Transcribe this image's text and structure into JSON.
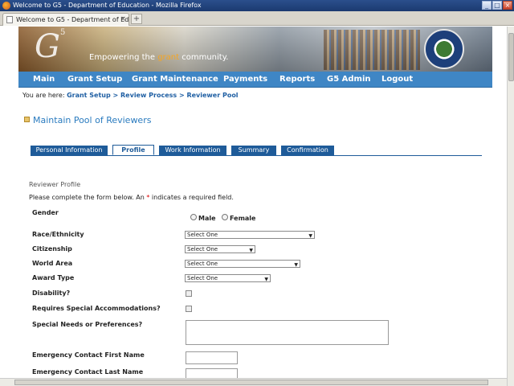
{
  "window": {
    "title": "Welcome to G5 - Department of Education - Mozilla Firefox"
  },
  "browser": {
    "tab_title": "Welcome to G5 - Department of Edu...",
    "tab_close": "×",
    "new_tab": "+"
  },
  "window_controls": {
    "minimize": "_",
    "maximize": "□",
    "close": "×"
  },
  "banner": {
    "logo": "G",
    "logo_sup": "5",
    "tagline_before": "Empowering the ",
    "tagline_highlight": "grant",
    "tagline_after": " community."
  },
  "nav": {
    "items": [
      "Main",
      "Grant Setup",
      "Grant Maintenance",
      "Payments",
      "Reports",
      "G5 Admin",
      "Logout"
    ]
  },
  "breadcrumb": {
    "prefix": "You are here: ",
    "crumbs": [
      "Grant Setup",
      "Review Process",
      "Reviewer Pool"
    ],
    "separator": " > "
  },
  "page_title": "Maintain Pool of Reviewers",
  "form_tabs": [
    "Personal Information",
    "Profile",
    "Work Information",
    "Summary",
    "Confirmation"
  ],
  "active_tab": "Profile",
  "section_title": "Reviewer Profile",
  "instructions": {
    "before": "Please complete the form below. An ",
    "star": "*",
    "after": " indicates a required field."
  },
  "fields": {
    "gender": {
      "label": "Gender",
      "options": [
        "Male",
        "Female"
      ]
    },
    "race": {
      "label": "Race/Ethnicity",
      "value": "Select One"
    },
    "citizenship": {
      "label": "Citizenship",
      "value": "Select One"
    },
    "world_area": {
      "label": "World Area",
      "value": "Select One"
    },
    "award_type": {
      "label": "Award Type",
      "value": "Select One"
    },
    "disability": {
      "label": "Disability?"
    },
    "accommodations": {
      "label": "Requires Special Accommodations?"
    },
    "special_needs": {
      "label": "Special Needs or Preferences?"
    },
    "emergency_first": {
      "label": "Emergency Contact First Name"
    },
    "emergency_last": {
      "label": "Emergency Contact Last Name"
    }
  }
}
